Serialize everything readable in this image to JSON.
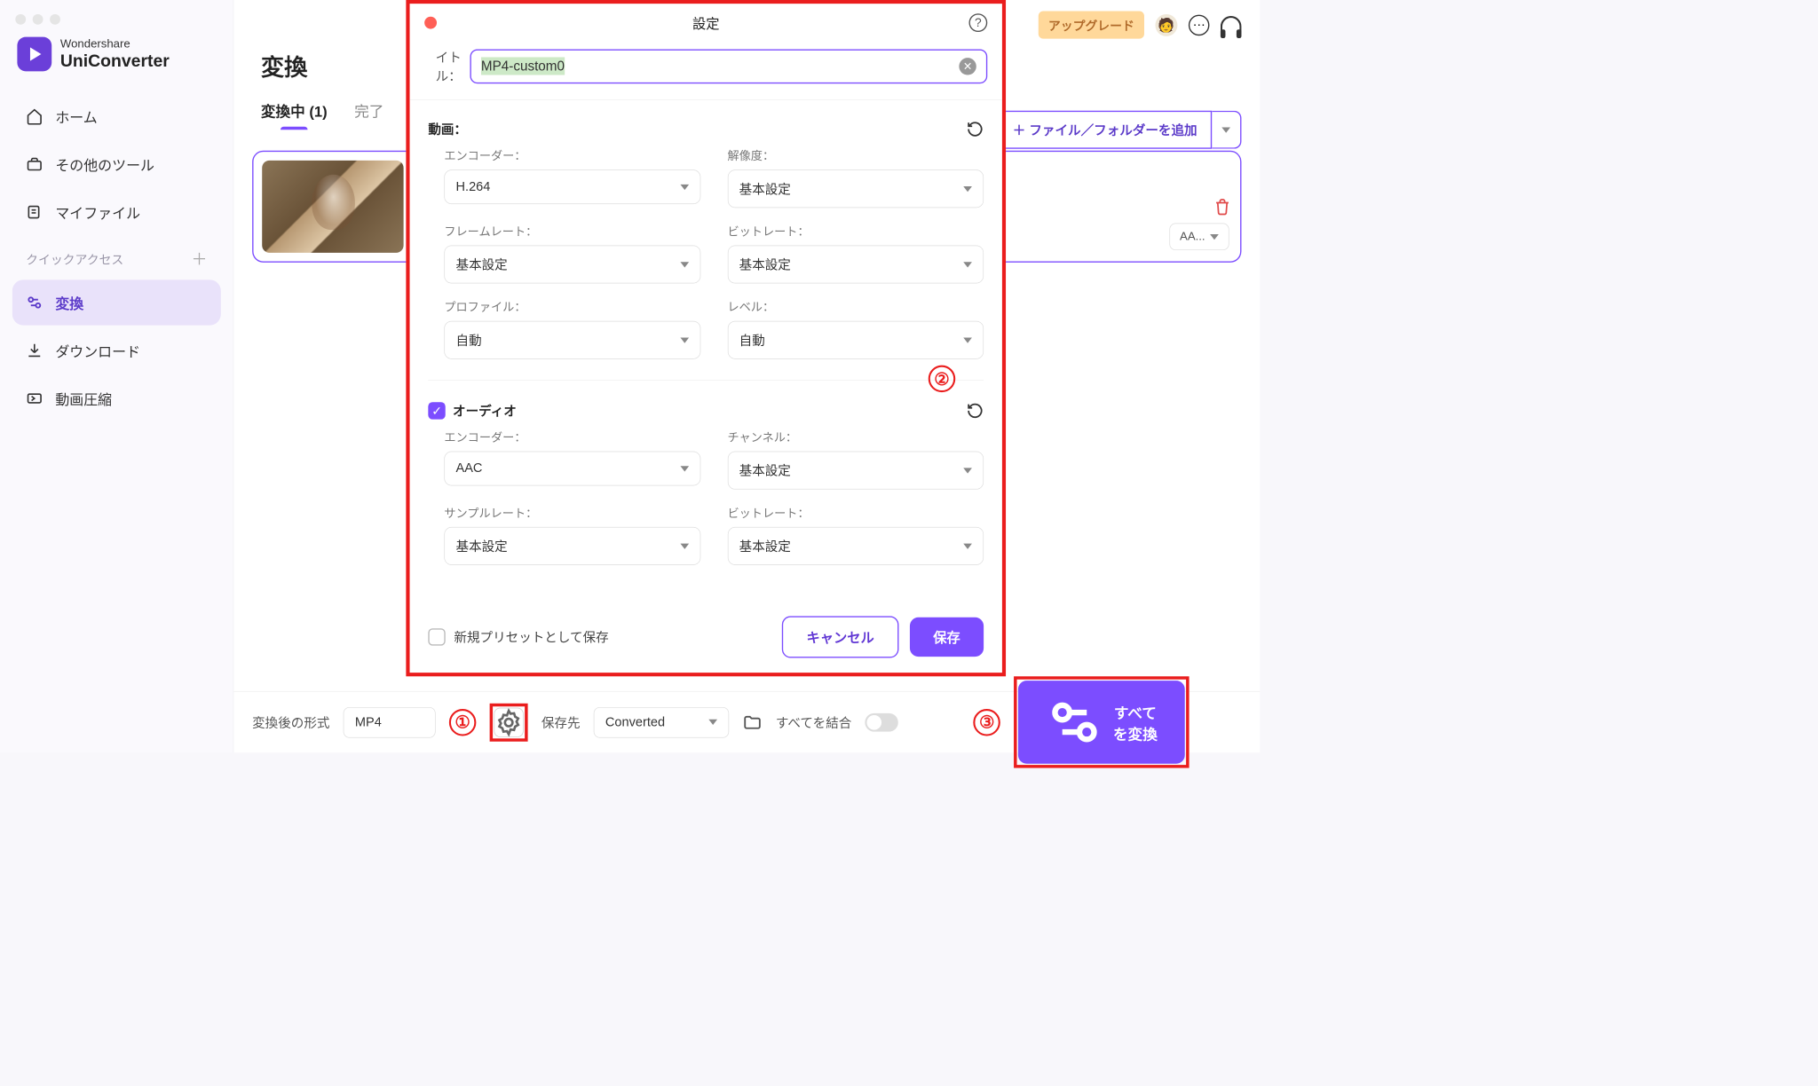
{
  "app": {
    "brand1": "Wondershare",
    "brand2": "UniConverter"
  },
  "sidebar": {
    "items": [
      {
        "label": "ホーム"
      },
      {
        "label": "その他のツール"
      },
      {
        "label": "マイファイル"
      }
    ],
    "quick_label": "クイックアクセス",
    "quick_items": [
      {
        "label": "変換",
        "active": true
      },
      {
        "label": "ダウンロード"
      },
      {
        "label": "動画圧縮"
      }
    ]
  },
  "header": {
    "upgrade": "アップグレード"
  },
  "page": {
    "title": "変換",
    "tabs": [
      {
        "label": "変換中 (1)",
        "active": true
      },
      {
        "label": "完了"
      }
    ],
    "add_file": "＋ ファイル／フォルダーを追加",
    "file_chip": "AA..."
  },
  "bottom": {
    "format_label": "変換後の形式",
    "format_value": "MP4",
    "savedir_label": "保存先",
    "savedir_value": "Converted",
    "merge_label": "すべてを結合",
    "convert_all": "すべてを変換"
  },
  "modal": {
    "title": "設定",
    "title_label": "イトル：",
    "title_value": "MP4-custom0",
    "video_label": "動画：",
    "audio_label": "オーディオ",
    "fields": {
      "encoder": "エンコーダー：",
      "resolution": "解像度：",
      "framerate": "フレームレート：",
      "bitrate": "ビットレート：",
      "profile": "プロファイル：",
      "level": "レベル：",
      "channel": "チャンネル：",
      "samplerate": "サンプルレート："
    },
    "values": {
      "v_encoder": "H.264",
      "v_resolution": "基本設定",
      "v_framerate": "基本設定",
      "v_bitrate": "基本設定",
      "v_profile": "自動",
      "v_level": "自動",
      "a_encoder": "AAC",
      "a_channel": "基本設定",
      "a_samplerate": "基本設定",
      "a_bitrate": "基本設定"
    },
    "save_preset": "新規プリセットとして保存",
    "cancel": "キャンセル",
    "save": "保存"
  },
  "callouts": {
    "c1": "①",
    "c2": "②",
    "c3": "③"
  }
}
